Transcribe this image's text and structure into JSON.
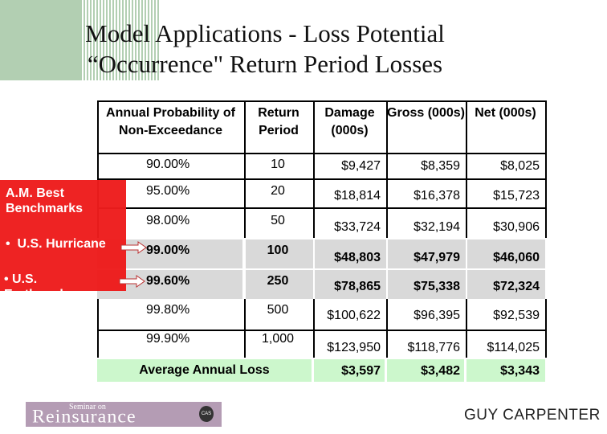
{
  "title": {
    "line1": "Model Applications - Loss Potential",
    "line2": "“Occurrence\" Return Period Losses"
  },
  "table": {
    "headers": [
      "Annual Probability of Non-Exceedance",
      "Return Period",
      "Damage (000s)",
      "Gross (000s)",
      "Net (000s)"
    ],
    "rows": [
      {
        "prob": "90.00%",
        "period": "10",
        "damage": "$9,427",
        "gross": "$8,359",
        "net": "$8,025",
        "highlight": false
      },
      {
        "prob": "95.00%",
        "period": "20",
        "damage": "$18,814",
        "gross": "$16,378",
        "net": "$15,723",
        "highlight": false
      },
      {
        "prob": "98.00%",
        "period": "50",
        "damage": "$33,724",
        "gross": "$32,194",
        "net": "$30,906",
        "highlight": false
      },
      {
        "prob": "99.00%",
        "period": "100",
        "damage": "$48,803",
        "gross": "$47,979",
        "net": "$46,060",
        "highlight": true
      },
      {
        "prob": "99.60%",
        "period": "250",
        "damage": "$78,865",
        "gross": "$75,338",
        "net": "$72,324",
        "highlight": true
      },
      {
        "prob": "99.80%",
        "period": "500",
        "damage": "$100,622",
        "gross": "$96,395",
        "net": "$92,539",
        "highlight": false
      },
      {
        "prob": "99.90%",
        "period": "1,000",
        "damage": "$123,950",
        "gross": "$118,776",
        "net": "$114,025",
        "highlight": false
      }
    ],
    "average": {
      "label": "Average Annual Loss",
      "damage": "$3,597",
      "gross": "$3,482",
      "net": "$3,343"
    }
  },
  "callout": {
    "heading": "A.M. Best Benchmarks",
    "bullets": [
      "U.S. Hurricane",
      "U.S. Earthquake"
    ],
    "color": "#ee1c1c"
  },
  "footer": {
    "logo_small": "Seminar on",
    "logo_big": "Reinsurance",
    "logo_seal": "CAS",
    "brand": "GUY CARPENTER"
  },
  "colors": {
    "highlight_row": "#d9d9d9",
    "average_row": "#ccf7cc",
    "accent_green": "#b2cfb2"
  }
}
